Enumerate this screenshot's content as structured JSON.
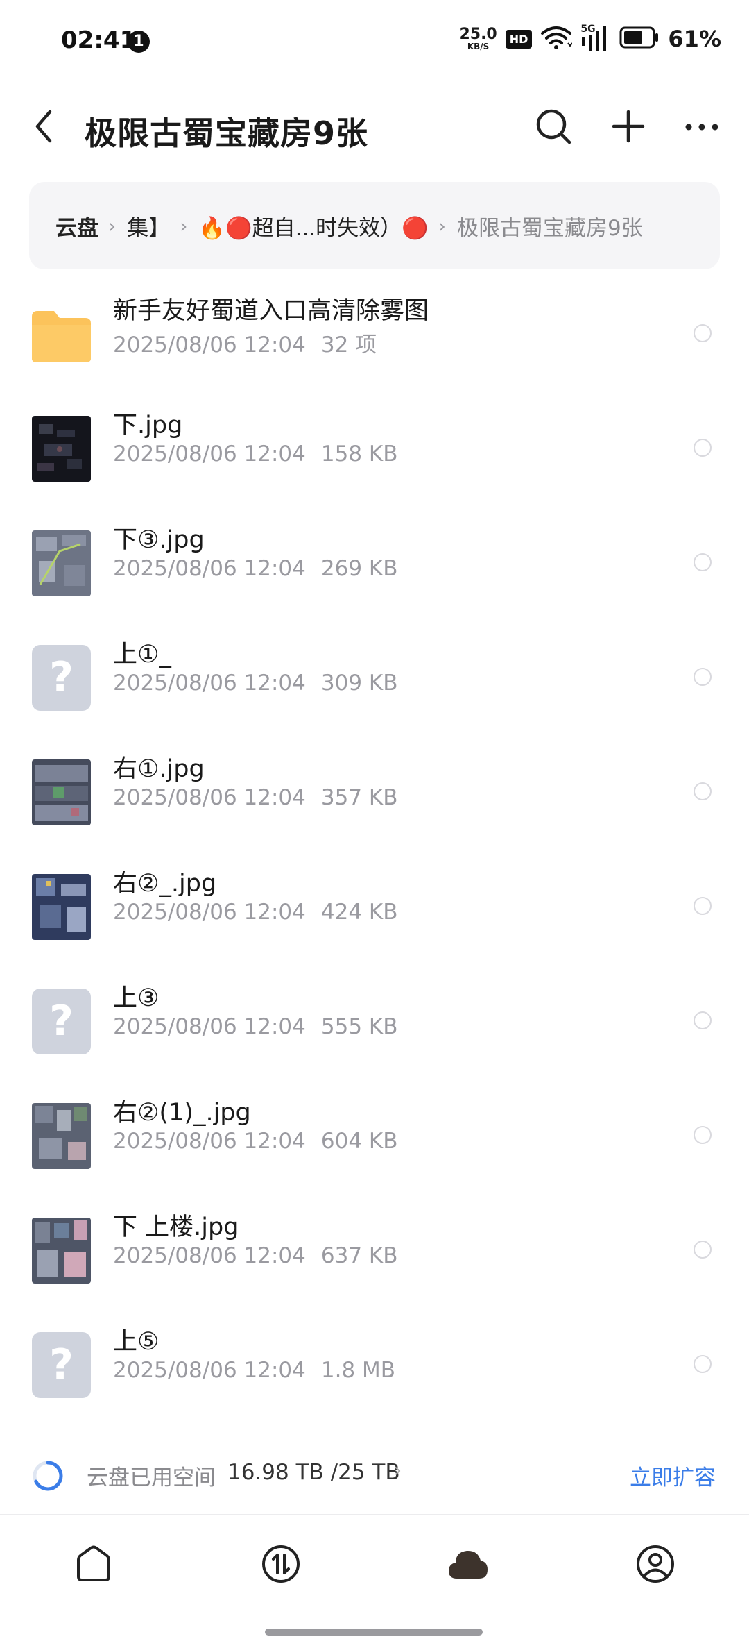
{
  "status_bar": {
    "time": "02:41",
    "notification_count": "1",
    "net_speed_value": "25.0",
    "net_speed_unit": "KB/S",
    "hd_label": "HD",
    "network_label": "5G",
    "battery_percent": "61%"
  },
  "header": {
    "title": "极限古蜀宝藏房9张"
  },
  "breadcrumb": {
    "items": [
      "云盘",
      "集】",
      "🔥🔴超自...时失效）🔴",
      "极限古蜀宝藏房9张"
    ]
  },
  "files": [
    {
      "name": "新手友好蜀道入口高清除雾图",
      "date": "2025/08/06 12:04",
      "size": "32 项",
      "thumb": "folder-icon"
    },
    {
      "name": "下.jpg",
      "date": "2025/08/06 12:04",
      "size": "158 KB",
      "thumb": "image-dark"
    },
    {
      "name": "下③.jpg",
      "date": "2025/08/06 12:04",
      "size": "269 KB",
      "thumb": "image-map"
    },
    {
      "name": "上①_",
      "date": "2025/08/06 12:04",
      "size": "309 KB",
      "thumb": "unknown-file-icon"
    },
    {
      "name": "右①.jpg",
      "date": "2025/08/06 12:04",
      "size": "357 KB",
      "thumb": "image-map"
    },
    {
      "name": "右②_.jpg",
      "date": "2025/08/06 12:04",
      "size": "424 KB",
      "thumb": "image-map"
    },
    {
      "name": "上③",
      "date": "2025/08/06 12:04",
      "size": "555 KB",
      "thumb": "unknown-file-icon"
    },
    {
      "name": "右②(1)_.jpg",
      "date": "2025/08/06 12:04",
      "size": "604 KB",
      "thumb": "image-map"
    },
    {
      "name": "下  上楼.jpg",
      "date": "2025/08/06 12:04",
      "size": "637 KB",
      "thumb": "image-map"
    },
    {
      "name": "上⑤",
      "date": "2025/08/06 12:04",
      "size": "1.8 MB",
      "thumb": "unknown-file-icon"
    }
  ],
  "storage": {
    "label": "云盘已用空间",
    "value": "16.98 TB /25 TB",
    "expand_label": "立即扩容",
    "used_fraction": 0.679
  },
  "colors": {
    "accent": "#3b7de8",
    "folder": "#fcc35b",
    "secondary_text": "#9a9aa0"
  },
  "bottom_nav": {
    "items": [
      "home-icon",
      "transfer-icon",
      "cloud-icon",
      "profile-icon"
    ],
    "active": "cloud-icon"
  }
}
